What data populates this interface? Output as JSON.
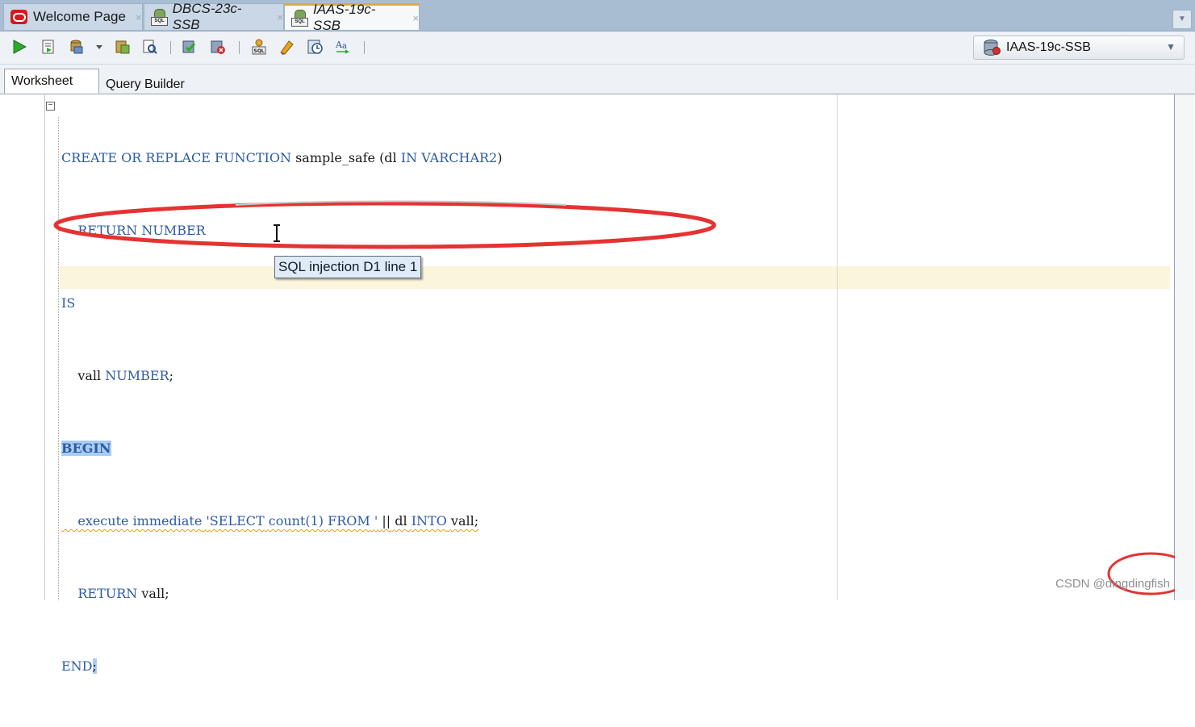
{
  "tabs": [
    {
      "label": "Welcome Page",
      "close": "×",
      "icon": "oracle-logo-icon"
    },
    {
      "label": "DBCS-23c-SSB",
      "close": "×",
      "icon": "sql-database-icon"
    },
    {
      "label": "IAAS-19c-SSB",
      "close": "×",
      "icon": "sql-database-icon",
      "active": true
    }
  ],
  "toolbar": {
    "icons": [
      "run-statement-icon",
      "run-script-icon",
      "commit-icon",
      "dropdown-arrow-icon",
      "explain-plan-icon",
      "autotrace-icon",
      "rollback-icon",
      "unshared-worksheet-icon",
      "sql-tuning-icon",
      "clear-icon",
      "sql-history-icon",
      "format-case-icon"
    ],
    "connection": "IAAS-19c-SSB"
  },
  "subtabs": [
    "Worksheet",
    "Query Builder"
  ],
  "code_lines": [
    "CREATE OR REPLACE FUNCTION sample_safe (dl IN VARCHAR2)",
    "    RETURN NUMBER",
    "IS",
    "    vall NUMBER;",
    "BEGIN",
    "    execute immediate 'SELECT count(1) FROM ' || dl INTO vall;",
    "    RETURN vall;",
    "END;"
  ],
  "code": {
    "l1_create": "CREATE",
    "l1_or": "OR",
    "l1_replace": "REPLACE",
    "l1_function": "FUNCTION",
    "l1_name": "sample_safe",
    "l1_open": "(dl",
    "l1_in": "IN",
    "l1_type": "VARCHAR2",
    "l1_close": ")",
    "l2_return": "RETURN",
    "l2_number": "NUMBER",
    "l3_is": "IS",
    "l4_var": "vall",
    "l4_number": "NUMBER",
    "l4_semi": ";",
    "l5_begin": "BEGIN",
    "l6_execute": "execute",
    "l6_immediate": "immediate",
    "l6_quote": "'",
    "l6_select": "SELECT",
    "l6_count": "count(1)",
    "l6_from": "FROM",
    "l6_endquote": "'",
    "l6_concat": "||",
    "l6_dl": "dl",
    "l6_into": "INTO",
    "l6_vall": "vall",
    "l6_semi": ";",
    "l7_return": "RETURN",
    "l7_vall": "vall;",
    "l8_end": "END",
    "l8_semi": ";"
  },
  "tooltip": "SQL injection D1 line 1",
  "watermark": "CSDN @dingdingfish",
  "colors": {
    "keyword": "#2c5aa6",
    "annotation_red": "#e53232",
    "current_line": "#fbf5dc",
    "selection": "#a9cdf2",
    "warning": "#f5c231"
  }
}
